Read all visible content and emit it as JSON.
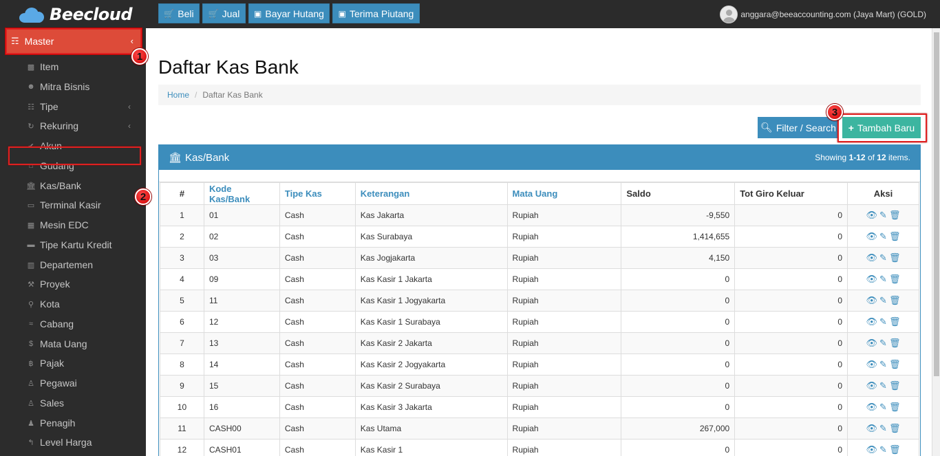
{
  "brand": {
    "name": "Beecloud"
  },
  "topbar": {
    "buttons": [
      {
        "label": "Beli",
        "icon": "cart-icon"
      },
      {
        "label": "Jual",
        "icon": "cart-icon"
      },
      {
        "label": "Bayar Hutang",
        "icon": "money-icon"
      },
      {
        "label": "Terima Piutang",
        "icon": "money-icon"
      }
    ],
    "user": "anggara@beeaccounting.com (Jaya Mart) (GOLD)"
  },
  "sidebar": {
    "master": "Master",
    "items": [
      {
        "label": "Item",
        "icon": "cube-icon"
      },
      {
        "label": "Mitra Bisnis",
        "icon": "users-icon"
      },
      {
        "label": "Tipe",
        "icon": "sitemap-icon"
      },
      {
        "label": "Rekuring",
        "icon": "refresh-icon"
      },
      {
        "label": "Akun",
        "icon": "check-icon"
      },
      {
        "label": "Gudang",
        "icon": "home-icon"
      },
      {
        "label": "Kas/Bank",
        "icon": "bank-icon"
      },
      {
        "label": "Terminal Kasir",
        "icon": "monitor-icon"
      },
      {
        "label": "Mesin EDC",
        "icon": "calculator-icon"
      },
      {
        "label": "Tipe Kartu Kredit",
        "icon": "credit-card-icon"
      },
      {
        "label": "Departemen",
        "icon": "building-icon"
      },
      {
        "label": "Proyek",
        "icon": "gavel-icon"
      },
      {
        "label": "Kota",
        "icon": "map-marker-icon"
      },
      {
        "label": "Cabang",
        "icon": "branch-icon"
      },
      {
        "label": "Mata Uang",
        "icon": "dollar-icon"
      },
      {
        "label": "Pajak",
        "icon": "bitcoin-icon"
      },
      {
        "label": "Pegawai",
        "icon": "male-icon"
      },
      {
        "label": "Sales",
        "icon": "male-icon"
      },
      {
        "label": "Penagih",
        "icon": "user-tie-icon"
      },
      {
        "label": "Level Harga",
        "icon": "level-up-icon"
      }
    ]
  },
  "annotations": {
    "badge1": "1",
    "badge2": "2",
    "badge3": "3"
  },
  "page": {
    "title": "Daftar Kas Bank",
    "breadcrumb": {
      "home": "Home",
      "current": "Daftar Kas Bank"
    },
    "filter_label": "Filter / Search",
    "add_label": "Tambah Baru"
  },
  "panel": {
    "title": "Kas/Bank",
    "summary_prefix": "Showing ",
    "summary_range": "1-12",
    "summary_of": " of ",
    "summary_total": "12",
    "summary_suffix": " items."
  },
  "table": {
    "headers": [
      "#",
      "Kode Kas/Bank",
      "Tipe Kas",
      "Keterangan",
      "Mata Uang",
      "Saldo",
      "Tot Giro Keluar",
      "Aksi"
    ],
    "rows": [
      [
        "1",
        "01",
        "Cash",
        "Kas Jakarta",
        "Rupiah",
        "-9,550",
        "0"
      ],
      [
        "2",
        "02",
        "Cash",
        "Kas Surabaya",
        "Rupiah",
        "1,414,655",
        "0"
      ],
      [
        "3",
        "03",
        "Cash",
        "Kas Jogjakarta",
        "Rupiah",
        "4,150",
        "0"
      ],
      [
        "4",
        "09",
        "Cash",
        "Kas Kasir 1 Jakarta",
        "Rupiah",
        "0",
        "0"
      ],
      [
        "5",
        "11",
        "Cash",
        "Kas Kasir 1 Jogyakarta",
        "Rupiah",
        "0",
        "0"
      ],
      [
        "6",
        "12",
        "Cash",
        "Kas Kasir 1 Surabaya",
        "Rupiah",
        "0",
        "0"
      ],
      [
        "7",
        "13",
        "Cash",
        "Kas Kasir 2 Jakarta",
        "Rupiah",
        "0",
        "0"
      ],
      [
        "8",
        "14",
        "Cash",
        "Kas Kasir 2 Jogyakarta",
        "Rupiah",
        "0",
        "0"
      ],
      [
        "9",
        "15",
        "Cash",
        "Kas Kasir 2 Surabaya",
        "Rupiah",
        "0",
        "0"
      ],
      [
        "10",
        "16",
        "Cash",
        "Kas Kasir 3 Jakarta",
        "Rupiah",
        "0",
        "0"
      ],
      [
        "11",
        "CASH00",
        "Cash",
        "Kas Utama",
        "Rupiah",
        "267,000",
        "0"
      ],
      [
        "12",
        "CASH01",
        "Cash",
        "Kas Kasir 1",
        "Rupiah",
        "0",
        "0"
      ]
    ]
  },
  "colors": {
    "primary": "#3c8dbc",
    "success": "#3cb5a0",
    "danger": "#dd4b39",
    "sidebar": "#2c2c2c"
  }
}
